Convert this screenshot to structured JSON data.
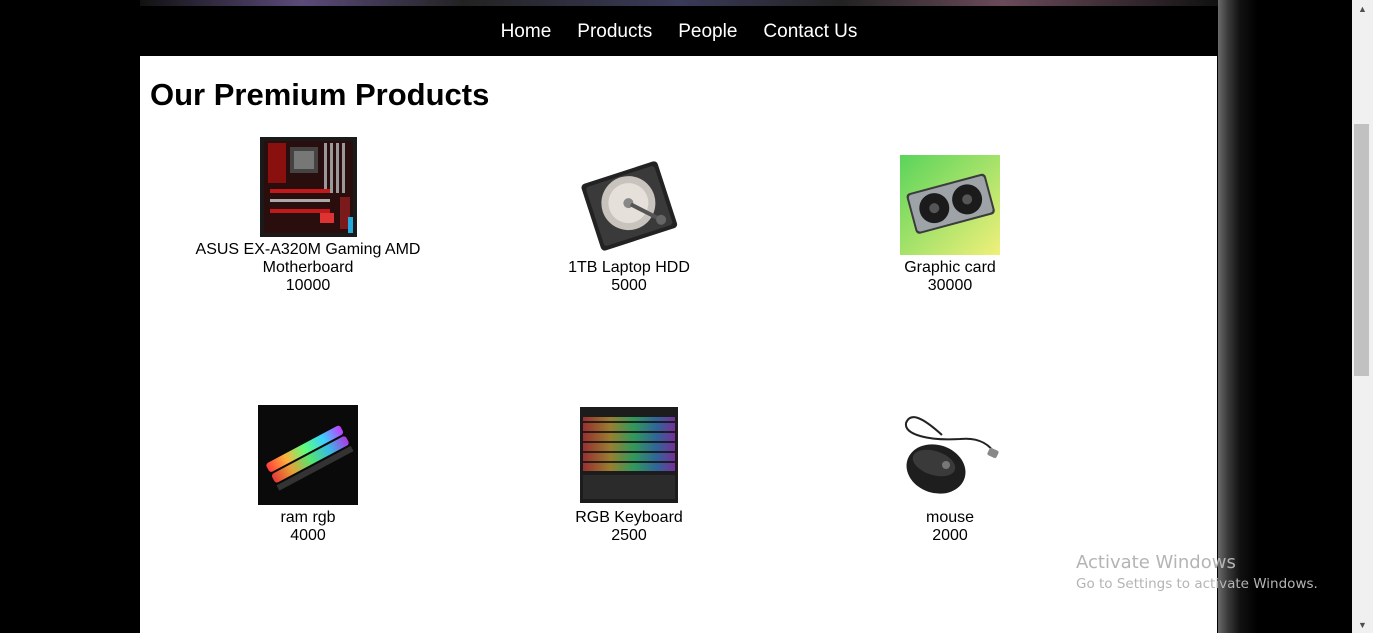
{
  "nav": {
    "items": [
      {
        "label": "Home"
      },
      {
        "label": "Products"
      },
      {
        "label": "People"
      },
      {
        "label": "Contact Us"
      }
    ]
  },
  "main": {
    "title": "Our Premium Products",
    "products": [
      {
        "name": "ASUS EX-A320M Gaming AMD Motherboard",
        "price": "10000",
        "icon": "motherboard-image"
      },
      {
        "name": "1TB Laptop HDD",
        "price": "5000",
        "icon": "hdd-image"
      },
      {
        "name": "Graphic card",
        "price": "30000",
        "icon": "graphic-card-image"
      },
      {
        "name": "ram rgb",
        "price": "4000",
        "icon": "ram-image"
      },
      {
        "name": "RGB Keyboard",
        "price": "2500",
        "icon": "keyboard-image"
      },
      {
        "name": "mouse",
        "price": "2000",
        "icon": "mouse-image"
      }
    ]
  },
  "watermark": {
    "title": "Activate Windows",
    "subtitle": "Go to Settings to activate Windows."
  }
}
